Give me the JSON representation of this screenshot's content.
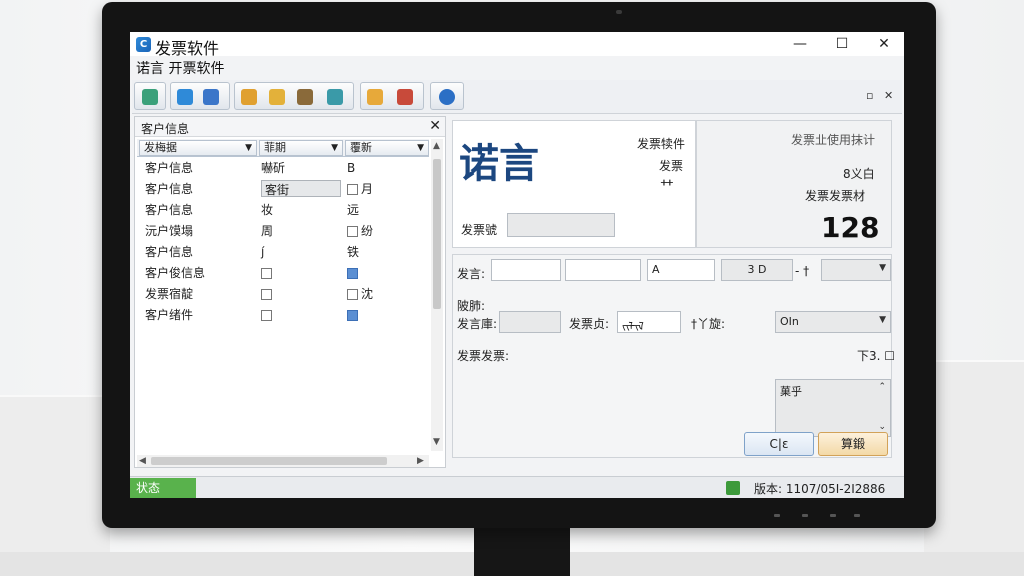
{
  "window": {
    "app_icon_glyph": "C",
    "title": "发票软件",
    "subtitle": "诺言 开票软件",
    "minimize": "—",
    "maximize": "☐",
    "close": "✕"
  },
  "toolbar": {
    "buttons": [
      {
        "name": "back",
        "icon": "arrow-up-icon",
        "color": "#3aa07a"
      },
      {
        "name": "up",
        "icon": "arrow-up-icon",
        "color": "#2f8ad8"
      },
      {
        "name": "chart",
        "icon": "bar-chart-icon",
        "color": "#3b76c9"
      },
      {
        "name": "transfer",
        "icon": "transfer-icon",
        "color": "#e0a030"
      },
      {
        "name": "add",
        "icon": "plus-folder-icon",
        "color": "#e3b13a"
      },
      {
        "name": "settings",
        "icon": "gear-icon",
        "color": "#8a6a3a"
      },
      {
        "name": "database",
        "icon": "database-icon",
        "color": "#3a9aa8"
      },
      {
        "name": "folder",
        "icon": "folder-icon",
        "color": "#e7a93a"
      },
      {
        "name": "tools",
        "icon": "tools-icon",
        "color": "#c84a3a"
      },
      {
        "name": "globe",
        "icon": "globe-icon",
        "color": "#2b6fc5"
      }
    ],
    "restore": "▫",
    "close": "✕"
  },
  "left_panel": {
    "title": "客户信息",
    "close": "✕",
    "columns": [
      "发梅据",
      "菲期",
      "覆新"
    ],
    "rows": [
      {
        "c1": "客户信息",
        "c2": "嚇斫",
        "c3": "B",
        "c2_type": "text",
        "c3_type": "text"
      },
      {
        "c1": "客户信息",
        "c2": "客街",
        "c3": "月",
        "c2_type": "selected",
        "c3_type": "checkbox"
      },
      {
        "c1": "客户信息",
        "c2": "妆",
        "c3": "远",
        "c2_type": "text",
        "c3_type": "text"
      },
      {
        "c1": "沅户馍塌",
        "c2": "周",
        "c3": "纷",
        "c2_type": "text",
        "c3_type": "checkbox"
      },
      {
        "c1": "客户信息",
        "c2": "j́",
        "c3": "铁",
        "c2_type": "text",
        "c3_type": "text"
      },
      {
        "c1": "客户俊信息",
        "c2": "",
        "c3": "",
        "c2_type": "checkbox",
        "c3_type": "checkbox-on"
      },
      {
        "c1": "发票宿靛",
        "c2": "",
        "c3": "沈",
        "c2_type": "checkbox",
        "c3_type": "checkbox"
      },
      {
        "c1": "客户绪件",
        "c2": "",
        "c3": "",
        "c2_type": "checkbox",
        "c3_type": "checkbox-on"
      }
    ]
  },
  "right_panel": {
    "customer_name": "诺言",
    "info_labels": [
      "发票犊件",
      "发票",
      "ᚐᚐ"
    ],
    "field_label": "发票號",
    "summary_label1": "发票㐀使用抹计",
    "summary_label2": "8义白",
    "summary_label3": "发票发票材",
    "invoice_number": "128",
    "row1_label": "发言:",
    "row1_fields": [
      "",
      "",
      "A",
      "3 D"
    ],
    "row1_sep": "- †",
    "row2_title": "陂肺:",
    "row2_label1": "发言庫:",
    "row2_label2": "发票贞:",
    "row2_value2": "ᠵᠢᠯ᠊ᠢᠯ",
    "row2_label3": "†丫旋:",
    "row2_value3": "OIn",
    "notes_label": "发票发票:",
    "notes_right": "下3. ☐",
    "notes_box_text": "菓乎",
    "cancel_button": "C|ɛ",
    "confirm_button": "算鍛"
  },
  "statusbar": {
    "status": "状态",
    "version": "版本: 1107/05I-2I2886"
  }
}
